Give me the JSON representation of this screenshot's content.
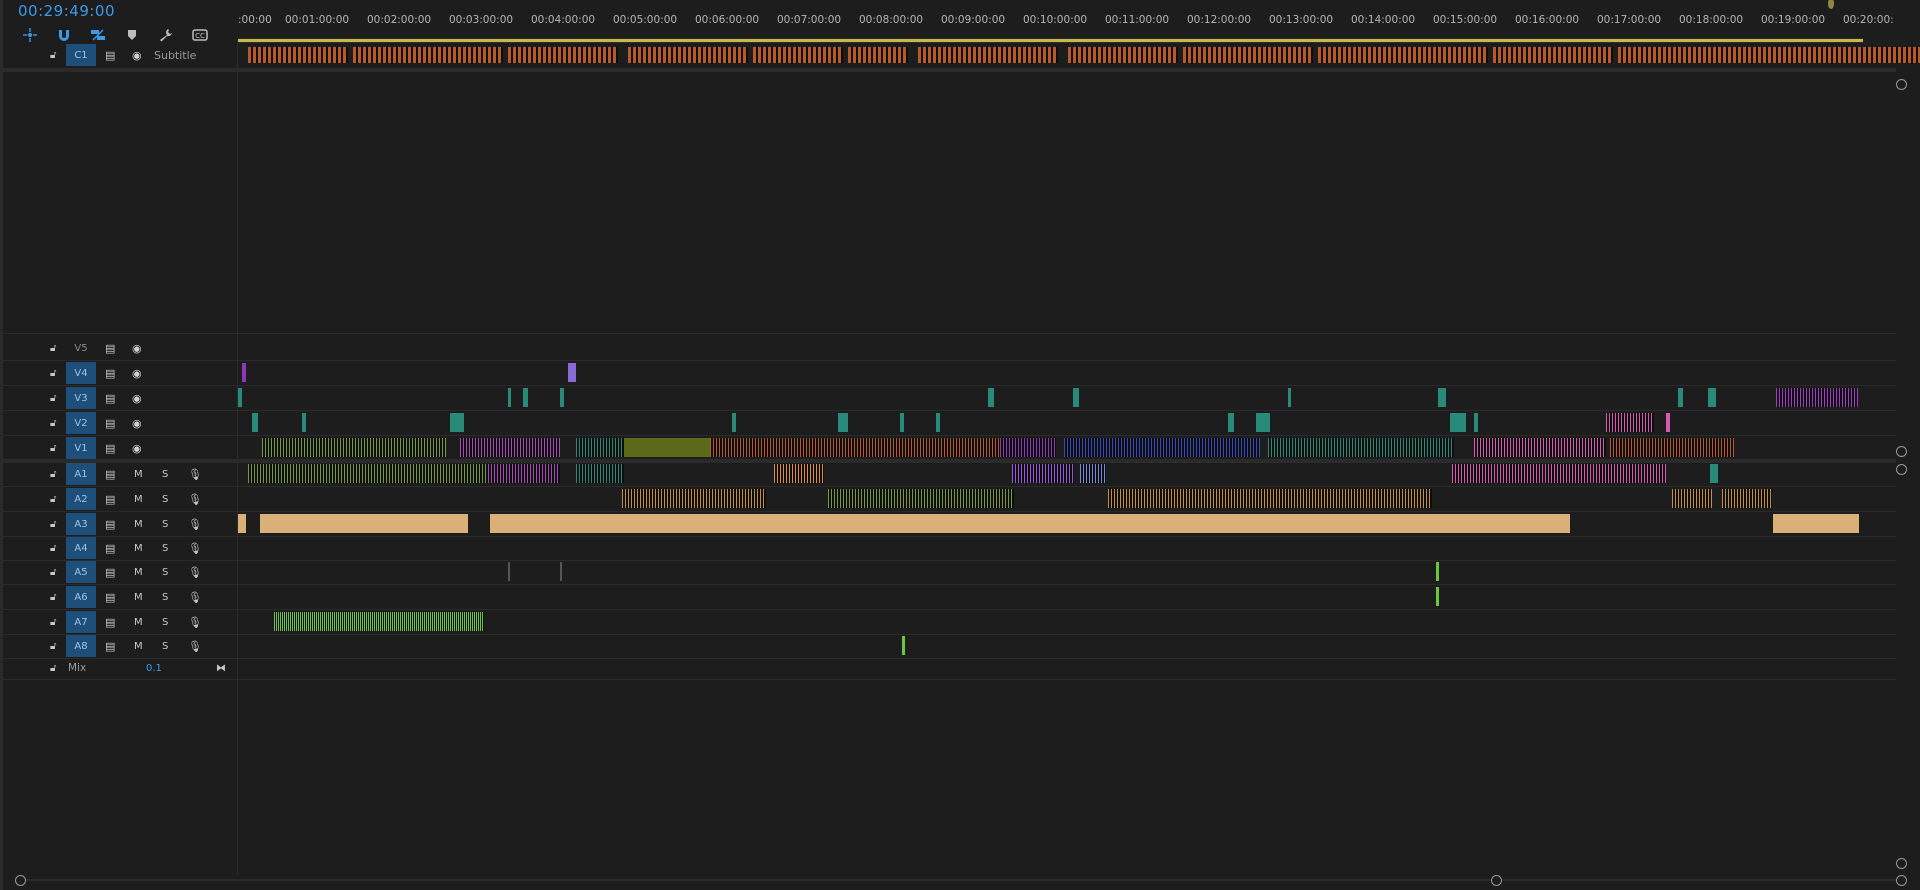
{
  "timecode": "00:29:49:00",
  "toolbar": {
    "tools": [
      "snap-icon",
      "magnet-icon",
      "linked-selection-icon",
      "add-marker-icon",
      "wrench-icon",
      "captions-icon"
    ]
  },
  "ruler": {
    "ticks": [
      ":00:00",
      "00:01:00:00",
      "00:02:00:00",
      "00:03:00:00",
      "00:04:00:00",
      "00:05:00:00",
      "00:06:00:00",
      "00:07:00:00",
      "00:08:00:00",
      "00:09:00:00",
      "00:10:00:00",
      "00:11:00:00",
      "00:12:00:00",
      "00:13:00:00",
      "00:14:00:00",
      "00:15:00:00",
      "00:16:00:00",
      "00:17:00:00",
      "00:18:00:00",
      "00:19:00:00",
      "00:20:00:"
    ]
  },
  "subtitle_track": {
    "name": "C1",
    "label": "Subtitle"
  },
  "video_tracks": [
    {
      "name": "V5",
      "active": false
    },
    {
      "name": "V4",
      "active": true
    },
    {
      "name": "V3",
      "active": true
    },
    {
      "name": "V2",
      "active": true
    },
    {
      "name": "V1",
      "active": true
    }
  ],
  "audio_tracks": [
    {
      "name": "A1",
      "m": "M",
      "s": "S"
    },
    {
      "name": "A2",
      "m": "M",
      "s": "S"
    },
    {
      "name": "A3",
      "m": "M",
      "s": "S"
    },
    {
      "name": "A4",
      "m": "M",
      "s": "S"
    },
    {
      "name": "A5",
      "m": "M",
      "s": "S"
    },
    {
      "name": "A6",
      "m": "M",
      "s": "S"
    },
    {
      "name": "A7",
      "m": "M",
      "s": "S"
    },
    {
      "name": "A8",
      "m": "M",
      "s": "S"
    }
  ],
  "mix": {
    "label": "Mix",
    "value": "0.1"
  },
  "colors": {
    "accent": "#3b9bea",
    "work_area": "#c8b84a",
    "clip_orange": "#b85a28",
    "clip_green": "#7a9a3a",
    "clip_purple": "#8a3ab8",
    "clip_teal": "#2a8a7a",
    "clip_pink": "#d65ab0",
    "clip_blue": "#3a4ab8",
    "clip_tan": "#d8b078",
    "clip_gold": "#c89030",
    "clip_lime": "#6ac83a"
  }
}
